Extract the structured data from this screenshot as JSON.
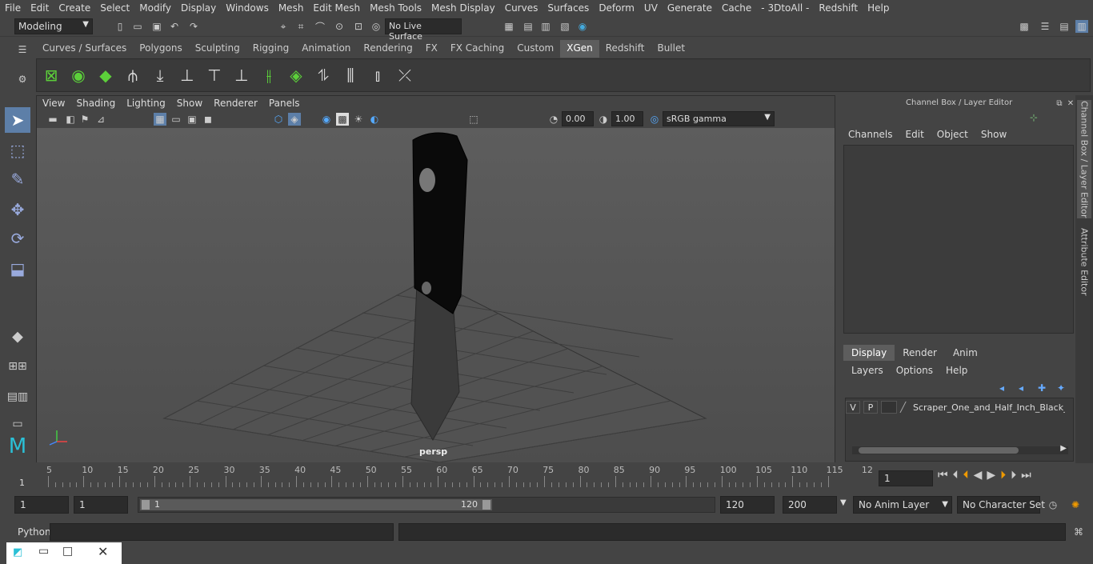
{
  "menubar": [
    "File",
    "Edit",
    "Create",
    "Select",
    "Modify",
    "Display",
    "Windows",
    "Mesh",
    "Edit Mesh",
    "Mesh Tools",
    "Mesh Display",
    "Curves",
    "Surfaces",
    "Deform",
    "UV",
    "Generate",
    "Cache",
    "- 3DtoAll -",
    "Redshift",
    "Help"
  ],
  "status": {
    "mode": "Modeling",
    "live_surface": "No Live Surface"
  },
  "shelf_tabs": [
    "Curves / Surfaces",
    "Polygons",
    "Sculpting",
    "Rigging",
    "Animation",
    "Rendering",
    "FX",
    "FX Caching",
    "Custom",
    "XGen",
    "Redshift",
    "Bullet"
  ],
  "shelf_active": "XGen",
  "viewport": {
    "menu": [
      "View",
      "Shading",
      "Lighting",
      "Show",
      "Renderer",
      "Panels"
    ],
    "exposure": "0.00",
    "gamma": "1.00",
    "colorspace": "sRGB gamma",
    "camera_label": "persp"
  },
  "channel_box": {
    "title": "Channel Box / Layer Editor",
    "menu": [
      "Channels",
      "Edit",
      "Object",
      "Show"
    ]
  },
  "layer_editor": {
    "tabs": [
      "Display",
      "Render",
      "Anim"
    ],
    "active_tab": "Display",
    "menu": [
      "Layers",
      "Options",
      "Help"
    ],
    "layer": {
      "v": "V",
      "p": "P",
      "name": "Scraper_One_and_Half_Inch_Black_Ha"
    }
  },
  "side_tabs": [
    "Channel Box / Layer Editor",
    "Attribute Editor"
  ],
  "timeline": {
    "ticks": [
      "5",
      "10",
      "15",
      "20",
      "25",
      "30",
      "35",
      "40",
      "45",
      "50",
      "55",
      "60",
      "65",
      "70",
      "75",
      "80",
      "85",
      "90",
      "95",
      "100",
      "105",
      "110",
      "115",
      "12"
    ],
    "start_label": "1",
    "current_frame": "1"
  },
  "range": {
    "start": "1",
    "inner_start": "1",
    "slider_start": "1",
    "slider_end": "120",
    "end": "120",
    "outer_end": "200",
    "anim_layer": "No Anim Layer",
    "character_set": "No Character Set"
  },
  "cmdline": {
    "label": "Python"
  }
}
